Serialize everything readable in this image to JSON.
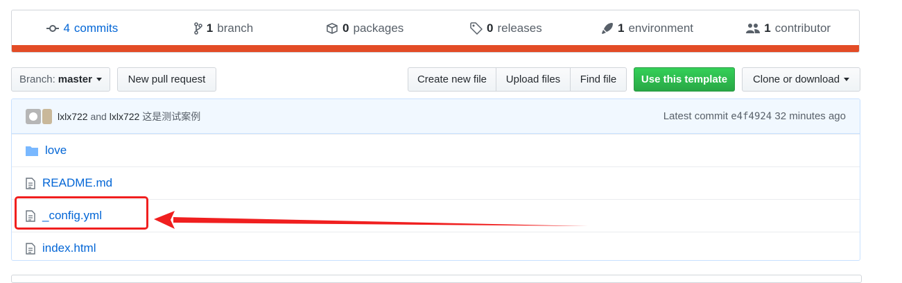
{
  "summary": {
    "commits": {
      "count": "4",
      "label": "commits"
    },
    "branch": {
      "count": "1",
      "label": "branch"
    },
    "packages": {
      "count": "0",
      "label": "packages"
    },
    "releases": {
      "count": "0",
      "label": "releases"
    },
    "environment": {
      "count": "1",
      "label": "environment"
    },
    "contributor": {
      "count": "1",
      "label": "contributor"
    },
    "language_color": "#e34c26"
  },
  "toolbar": {
    "branch_label": "Branch:",
    "branch_value": "master",
    "new_pr": "New pull request",
    "create_file": "Create new file",
    "upload_files": "Upload files",
    "find_file": "Find file",
    "use_template": "Use this template",
    "clone_download": "Clone or download"
  },
  "commit": {
    "author1": "lxlx722",
    "and": "and",
    "author2": "lxlx722",
    "message": "这是测试案例",
    "latest_label": "Latest commit",
    "sha": "e4f4924",
    "time": "32 minutes ago"
  },
  "files": [
    {
      "name": "love",
      "type": "folder"
    },
    {
      "name": "README.md",
      "type": "file"
    },
    {
      "name": "_config.yml",
      "type": "file"
    },
    {
      "name": "index.html",
      "type": "file"
    }
  ],
  "colors": {
    "accent": "#0366d6",
    "green": "#28a745",
    "annotation": "#f01f1f"
  }
}
